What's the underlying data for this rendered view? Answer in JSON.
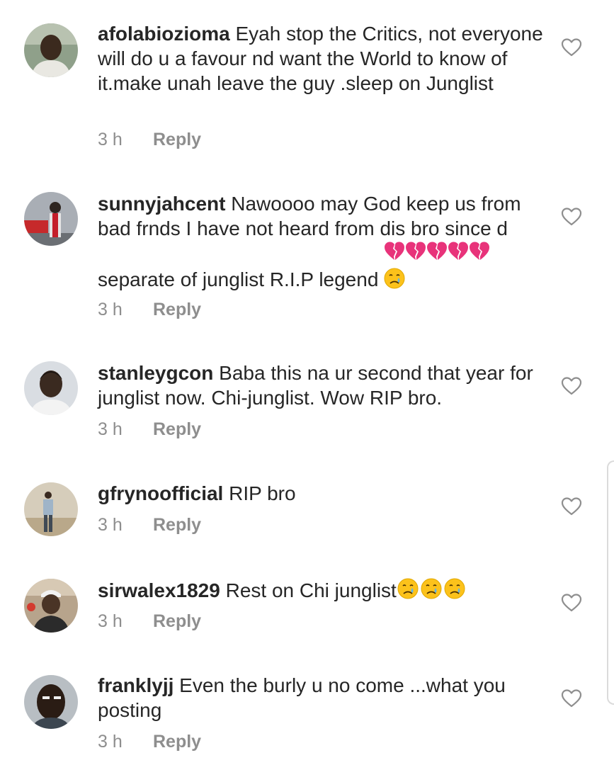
{
  "comments": [
    {
      "username": "afolabiozioma",
      "text": " Eyah stop the Critics, not everyone will do u a favour nd want the World to know of it.make unah leave the guy .sleep on Junglist",
      "time": "3 h",
      "reply": "Reply"
    },
    {
      "username": "sunnyjahcent",
      "text": " Nawoooo may God keep us from bad frnds I have not heard from dis bro since d separate of junglist R.I.P legend ",
      "emoji": "💔💔💔💔💔😢",
      "time": "3 h",
      "reply": "Reply"
    },
    {
      "username": "stanleygcon",
      "text": " Baba this na ur second that year for junglist now. Chi-junglist. Wow RIP bro.",
      "time": "3 h",
      "reply": "Reply"
    },
    {
      "username": "gfrynoofficial",
      "text": " RIP bro",
      "time": "3 h",
      "reply": "Reply"
    },
    {
      "username": "sirwalex1829",
      "text": " Rest on Chi junglist",
      "emoji": "😢😢😢",
      "time": "3 h",
      "reply": "Reply"
    },
    {
      "username": "franklyjj",
      "text": " Even the burly u no come ...what you posting",
      "time": "3 h",
      "reply": "Reply"
    }
  ],
  "icons": {
    "like": "heart-outline-icon"
  },
  "colors": {
    "text": "#262626",
    "secondary": "#8e8e8e",
    "heart_stroke": "#8e8e8e",
    "broken_heart": "#e8337a"
  }
}
